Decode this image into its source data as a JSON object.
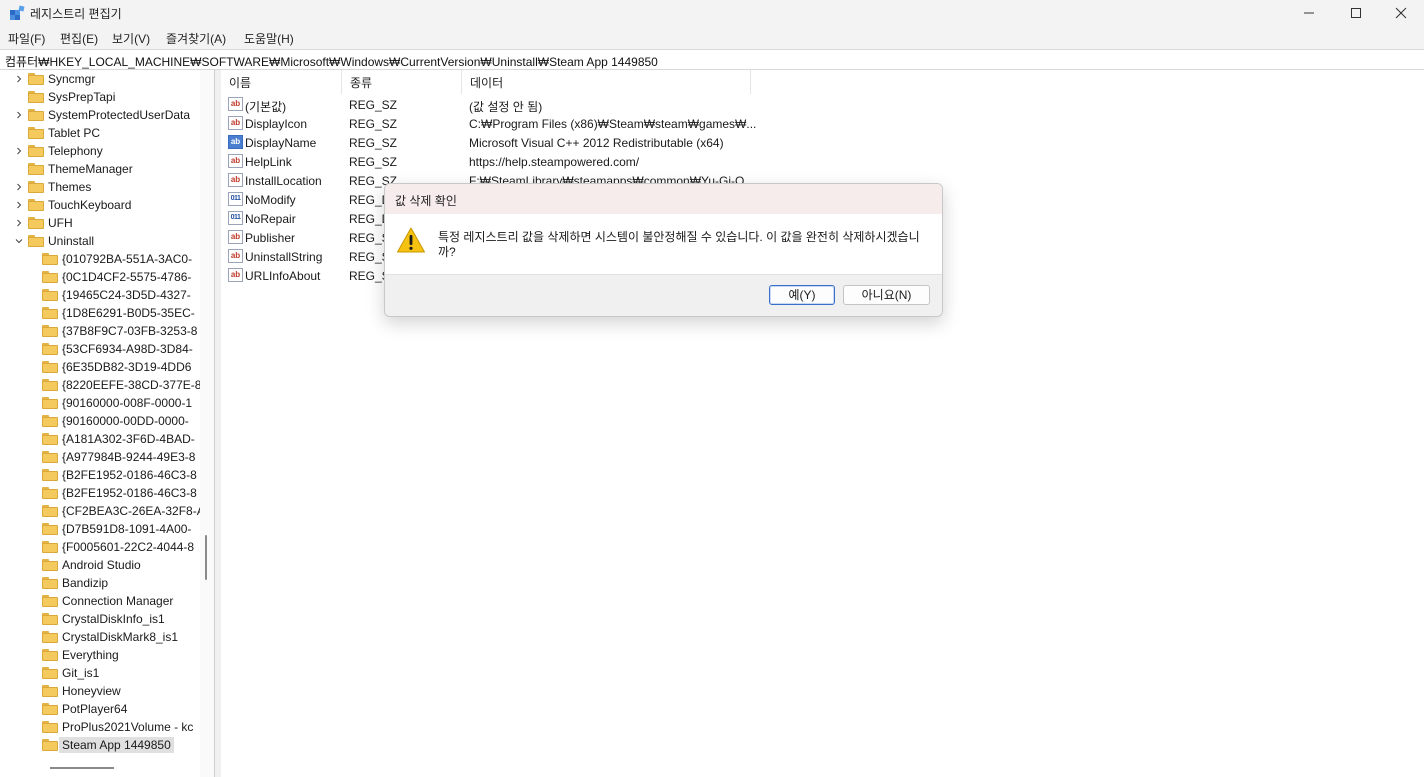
{
  "window": {
    "title": "레지스트리 편집기"
  },
  "menu": [
    "파일(F)",
    "편집(E)",
    "보기(V)",
    "즐겨찾기(A)",
    "도움말(H)"
  ],
  "address": "컴퓨터₩HKEY_LOCAL_MACHINE₩SOFTWARE₩Microsoft₩Windows₩CurrentVersion₩Uninstall₩Steam App 1449850",
  "tree": {
    "top_items": [
      {
        "label": "Syncmgr",
        "expandable": true
      },
      {
        "label": "SysPrepTapi",
        "expandable": false
      },
      {
        "label": "SystemProtectedUserData",
        "expandable": true
      },
      {
        "label": "Tablet PC",
        "expandable": false
      },
      {
        "label": "Telephony",
        "expandable": true
      },
      {
        "label": "ThemeManager",
        "expandable": false
      },
      {
        "label": "Themes",
        "expandable": true
      },
      {
        "label": "TouchKeyboard",
        "expandable": true
      },
      {
        "label": "UFH",
        "expandable": true
      },
      {
        "label": "Uninstall",
        "expandable": true,
        "expanded": true
      }
    ],
    "children": [
      "{010792BA-551A-3AC0-",
      "{0C1D4CF2-5575-4786-",
      "{19465C24-3D5D-4327-",
      "{1D8E6291-B0D5-35EC-",
      "{37B8F9C7-03FB-3253-8",
      "{53CF6934-A98D-3D84-",
      "{6E35DB82-3D19-4DD6",
      "{8220EEFE-38CD-377E-8",
      "{90160000-008F-0000-1",
      "{90160000-00DD-0000-",
      "{A181A302-3F6D-4BAD-",
      "{A977984B-9244-49E3-8",
      "{B2FE1952-0186-46C3-8",
      "{B2FE1952-0186-46C3-8",
      "{CF2BEA3C-26EA-32F8-A",
      "{D7B591D8-1091-4A00-",
      "{F0005601-22C2-4044-8",
      "Android Studio",
      "Bandizip",
      "Connection Manager",
      "CrystalDiskInfo_is1",
      "CrystalDiskMark8_is1",
      "Everything",
      "Git_is1",
      "Honeyview",
      "PotPlayer64",
      "ProPlus2021Volume - kc",
      "Steam App 1449850"
    ],
    "selected": "Steam App 1449850"
  },
  "columns": [
    "이름",
    "종류",
    "데이터"
  ],
  "values": [
    {
      "name": "(기본값)",
      "type": "REG_SZ",
      "data": "(값 설정 안 됨)",
      "icon": "string-icon"
    },
    {
      "name": "DisplayIcon",
      "type": "REG_SZ",
      "data": "C:₩Program Files (x86)₩Steam₩steam₩games₩...",
      "icon": "string-icon"
    },
    {
      "name": "DisplayName",
      "type": "REG_SZ",
      "data": "Microsoft Visual C++ 2012 Redistributable (x64)",
      "icon": "string-icon-selected"
    },
    {
      "name": "HelpLink",
      "type": "REG_SZ",
      "data": "https://help.steampowered.com/",
      "icon": "string-icon"
    },
    {
      "name": "InstallLocation",
      "type": "REG_SZ",
      "data": "F:₩SteamLibrary₩steamapps₩common₩Yu-Gi-O",
      "icon": "string-icon"
    },
    {
      "name": "NoModify",
      "type": "REG_D",
      "data": "",
      "icon": "binary-icon"
    },
    {
      "name": "NoRepair",
      "type": "REG_D",
      "data": "",
      "icon": "binary-icon"
    },
    {
      "name": "Publisher",
      "type": "REG_S",
      "data": "",
      "icon": "string-icon"
    },
    {
      "name": "UninstallString",
      "type": "REG_S",
      "data": "",
      "icon": "string-icon"
    },
    {
      "name": "URLInfoAbout",
      "type": "REG_S",
      "data": "",
      "icon": "string-icon"
    }
  ],
  "dialog": {
    "title": "값 삭제 확인",
    "message": "특정 레지스트리 값을 삭제하면 시스템이 불안정해질 수 있습니다. 이 값을 완전히 삭제하시겠습니까?",
    "yes_label": "예(Y)",
    "no_label": "아니요(N)"
  },
  "icons": {
    "icon_text": "ab",
    "binary_text": "011"
  }
}
